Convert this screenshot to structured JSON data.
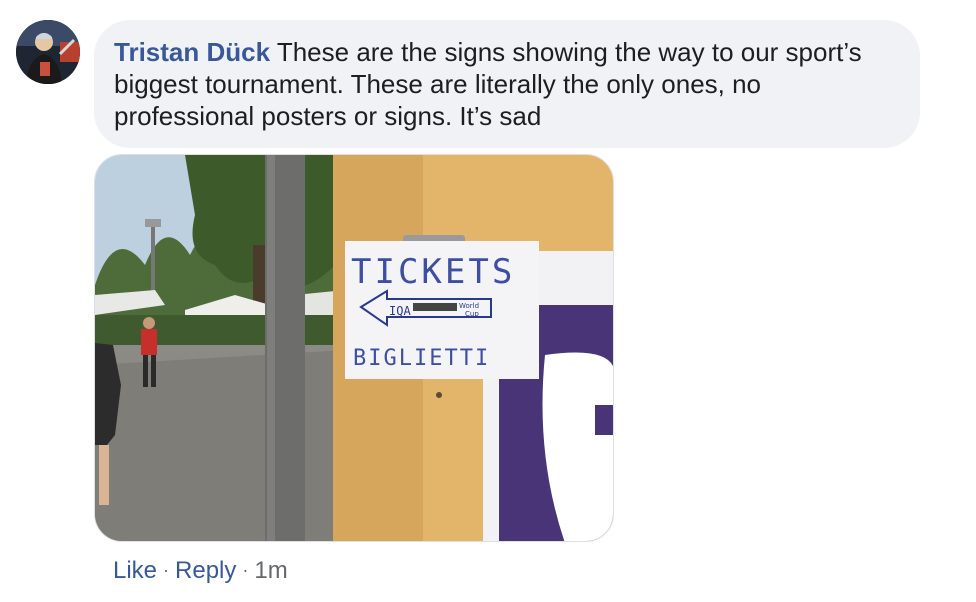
{
  "comment": {
    "author": "Tristan Dück",
    "text": "These are the signs showing the way to our sport’s biggest tournament. These are literally the only ones, no professional posters or signs. It’s sad",
    "actions": {
      "like_label": "Like",
      "reply_label": "Reply",
      "separator": "·",
      "timestamp": "1m"
    },
    "photo": {
      "sign_heading": "TICKETS",
      "sign_arrow_text": "IQA",
      "sign_arrow_small_line1": "World",
      "sign_arrow_small_line2": "Cup",
      "sign_footer": "BIGLIETTI"
    }
  },
  "colors": {
    "author_link": "#385898",
    "bubble_bg": "#f0f2f5",
    "meta_text": "#65676b"
  }
}
